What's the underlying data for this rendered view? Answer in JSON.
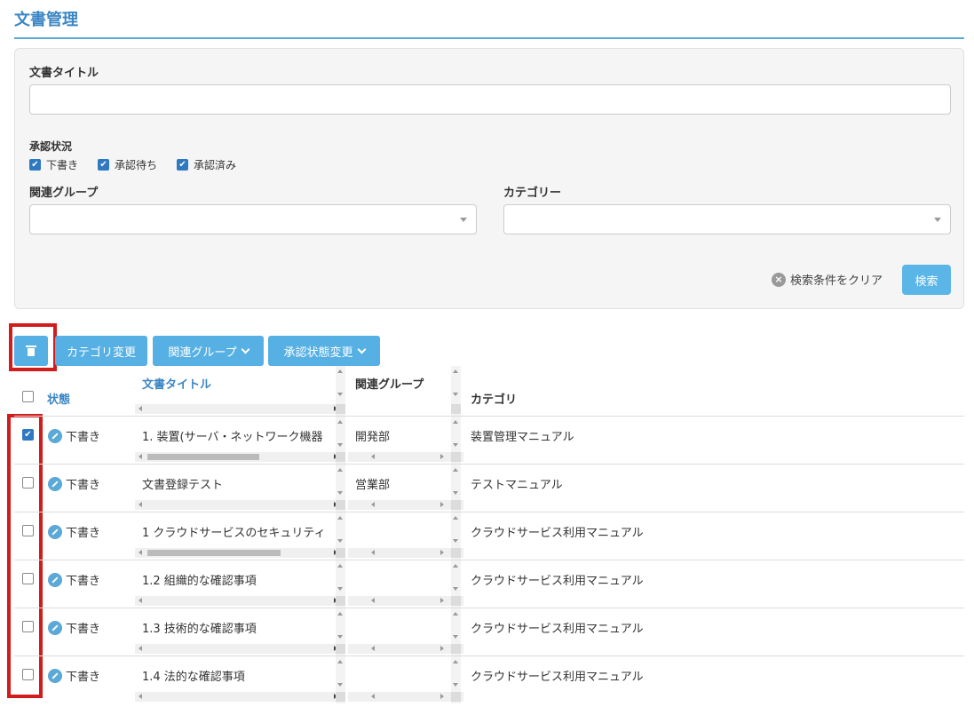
{
  "page": {
    "title": "文書管理"
  },
  "search": {
    "doc_title_label": "文書タイトル",
    "doc_title_value": "",
    "approval_label": "承認状況",
    "approval_options": [
      {
        "label": "下書き",
        "checked": true
      },
      {
        "label": "承認待ち",
        "checked": true
      },
      {
        "label": "承認済み",
        "checked": true
      }
    ],
    "group_label": "関連グループ",
    "group_value": "",
    "category_label": "カテゴリー",
    "category_value": "",
    "clear_label": "検索条件をクリア",
    "search_label": "検索"
  },
  "toolbar": {
    "delete_icon": "trash-icon",
    "category_change": "カテゴリ変更",
    "related_group": "関連グループ",
    "approval_change": "承認状態変更"
  },
  "table": {
    "headers": {
      "status": "状態",
      "title": "文書タイトル",
      "group": "関連グループ",
      "category": "カテゴリ"
    },
    "rows": [
      {
        "checked": true,
        "status": "下書き",
        "title": "1. 装置(サーバ・ネットワーク機器",
        "group": "開発部",
        "category": "装置管理マニュアル"
      },
      {
        "checked": false,
        "status": "下書き",
        "title": "文書登録テスト",
        "group": "営業部",
        "category": "テストマニュアル"
      },
      {
        "checked": false,
        "status": "下書き",
        "title": "1 クラウドサービスのセキュリティ",
        "group": "",
        "category": "クラウドサービス利用マニュアル"
      },
      {
        "checked": false,
        "status": "下書き",
        "title": "1.2 組織的な確認事項",
        "group": "",
        "category": "クラウドサービス利用マニュアル"
      },
      {
        "checked": false,
        "status": "下書き",
        "title": "1.3 技術的な確認事項",
        "group": "",
        "category": "クラウドサービス利用マニュアル"
      },
      {
        "checked": false,
        "status": "下書き",
        "title": "1.4 法的な確認事項",
        "group": "",
        "category": "クラウドサービス利用マニュアル"
      }
    ]
  },
  "colors": {
    "accent": "#3b86c4",
    "button": "#56b0e3",
    "highlight": "#d11c1c"
  }
}
